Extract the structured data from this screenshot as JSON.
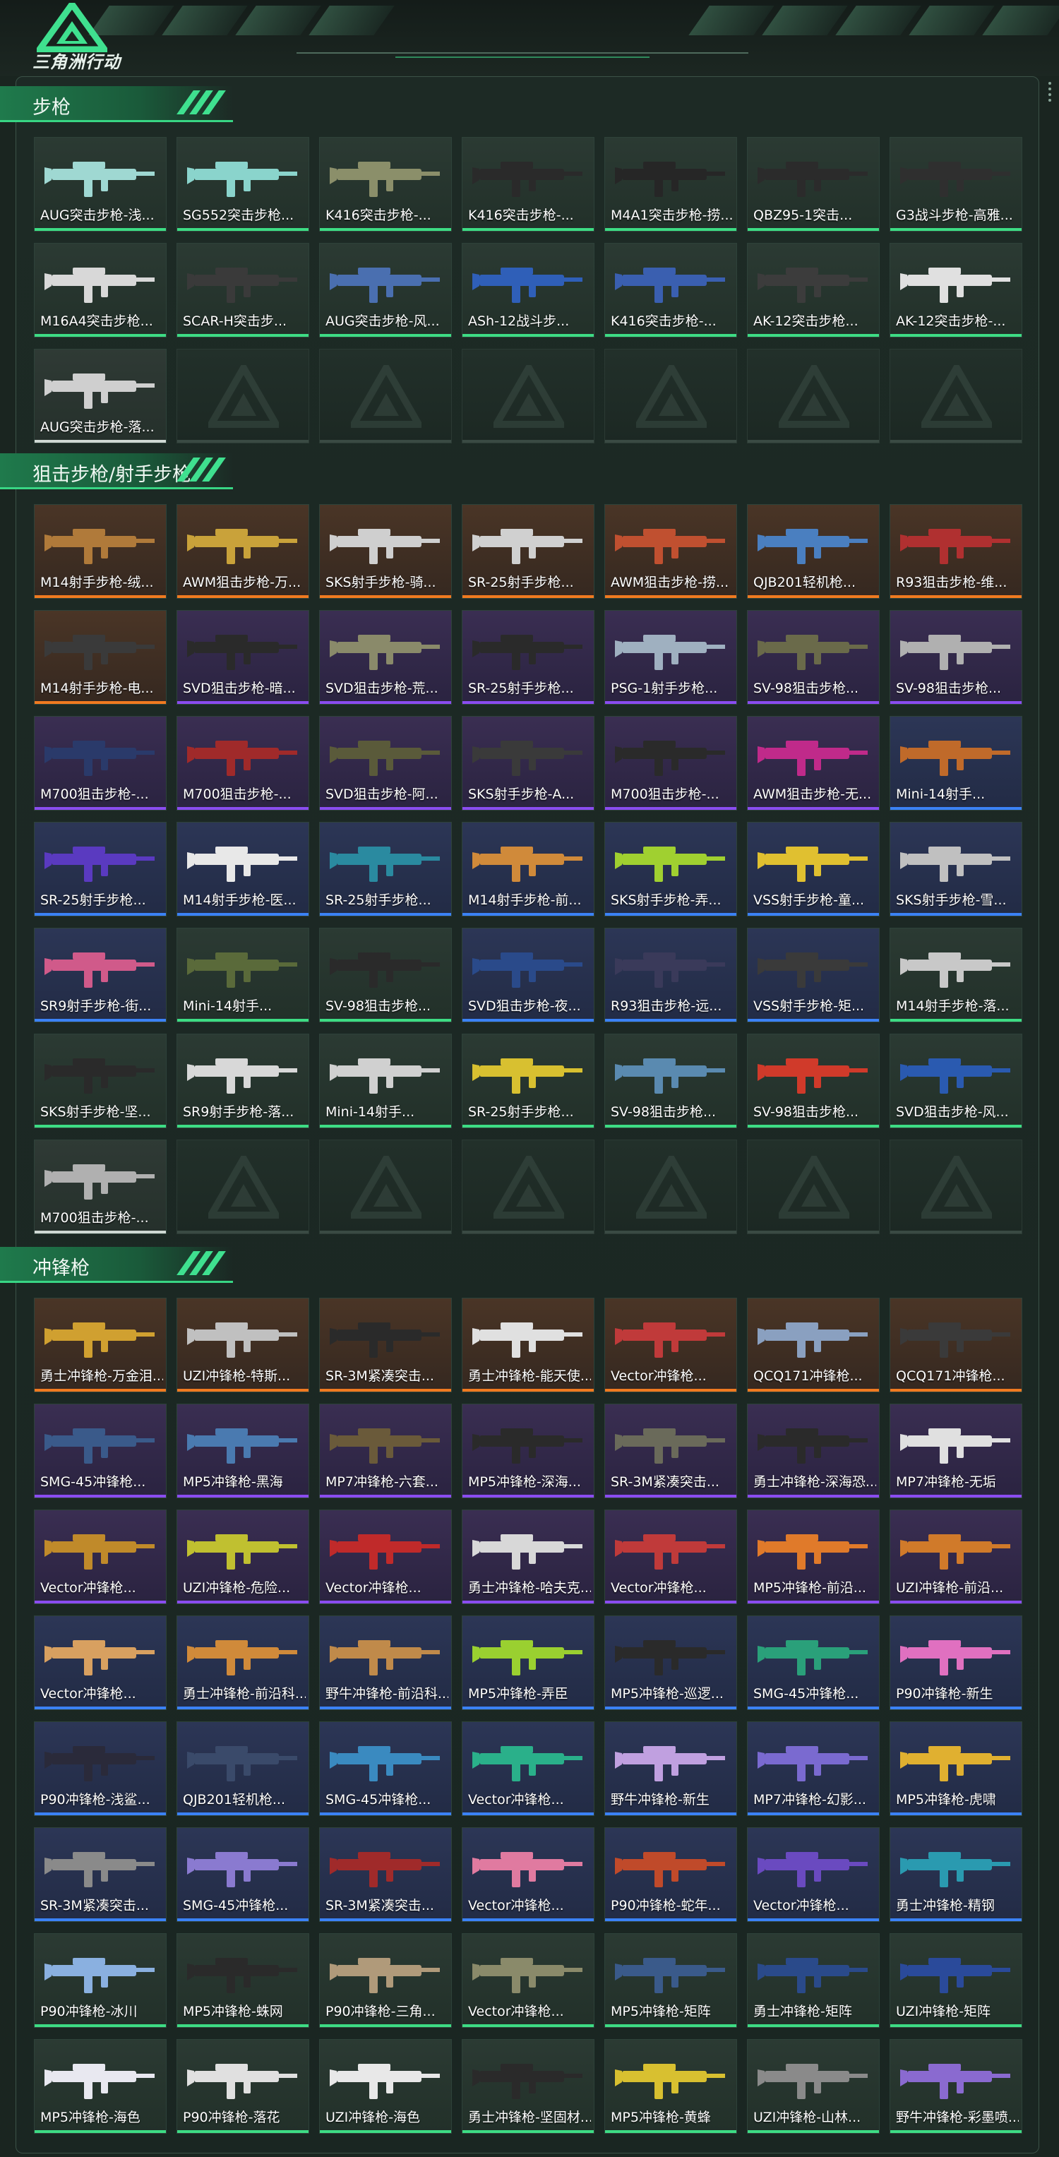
{
  "app": {
    "logo_text": "三角洲行动"
  },
  "colors": {
    "green_bar": "#3ddc84",
    "orange_bar": "#f07a20",
    "purple_bar": "#8a4cf0",
    "blue_bar": "#3b82f6",
    "white_bar": "#cfd8d3"
  },
  "sections": [
    {
      "title": "步枪",
      "items": [
        {
          "label": "AUG突击步枪-浅...",
          "rarity": "green",
          "gun": "#9fd8d2"
        },
        {
          "label": "SG552突击步枪...",
          "rarity": "green",
          "gun": "#8ad4cc"
        },
        {
          "label": "K416突击步枪-...",
          "rarity": "green",
          "gun": "#8b8f6a"
        },
        {
          "label": "K416突击步枪-...",
          "rarity": "green",
          "gun": "#2a2a2a"
        },
        {
          "label": "M4A1突击步枪-捞...",
          "rarity": "green",
          "gun": "#262626"
        },
        {
          "label": "QBZ95-1突击...",
          "rarity": "green",
          "gun": "#2b2b2b"
        },
        {
          "label": "G3战斗步枪-高雅...",
          "rarity": "green",
          "gun": "#2f2f2f"
        },
        {
          "label": "M16A4突击步枪...",
          "rarity": "green",
          "gun": "#d8d8d8"
        },
        {
          "label": "SCAR-H突击步...",
          "rarity": "green",
          "gun": "#3a3a3a"
        },
        {
          "label": "AUG突击步枪-风...",
          "rarity": "green",
          "gun": "#4a6fb0"
        },
        {
          "label": "ASh-12战斗步...",
          "rarity": "green",
          "gun": "#2f5fb8"
        },
        {
          "label": "K416突击步枪-...",
          "rarity": "green",
          "gun": "#3a5fb0"
        },
        {
          "label": "AK-12突击步枪...",
          "rarity": "green",
          "gun": "#3c3c3c"
        },
        {
          "label": "AK-12突击步枪-...",
          "rarity": "green",
          "gun": "#e0e0e0"
        },
        {
          "label": "AUG突击步枪-落...",
          "rarity": "white",
          "gun": "#cfcfcf"
        }
      ]
    },
    {
      "title": "狙击步枪/射手步枪",
      "items": [
        {
          "label": "M14射手步枪-绒...",
          "rarity": "orange",
          "gun": "#b07a3a"
        },
        {
          "label": "AWM狙击步枪-万...",
          "rarity": "orange",
          "gun": "#c9a23a"
        },
        {
          "label": "SKS射手步枪-骑...",
          "rarity": "orange",
          "gun": "#cfcfcf"
        },
        {
          "label": "SR-25射手步枪...",
          "rarity": "orange",
          "gun": "#d0d0d0"
        },
        {
          "label": "AWM狙击步枪-捞...",
          "rarity": "orange",
          "gun": "#c05030"
        },
        {
          "label": "QJB201轻机枪...",
          "rarity": "orange",
          "gun": "#4a7fc0"
        },
        {
          "label": "R93狙击步枪-维...",
          "rarity": "orange",
          "gun": "#b03030"
        },
        {
          "label": "M14射手步枪-电...",
          "rarity": "orange",
          "gun": "#3a3a3a"
        },
        {
          "label": "SVD狙击步枪-暗...",
          "rarity": "purple",
          "gun": "#2a2a2a"
        },
        {
          "label": "SVD狙击步枪-荒...",
          "rarity": "purple",
          "gun": "#8a8a6a"
        },
        {
          "label": "SR-25射手步枪...",
          "rarity": "purple",
          "gun": "#2a2a2a"
        },
        {
          "label": "PSG-1射手步枪...",
          "rarity": "purple",
          "gun": "#9fb0c0"
        },
        {
          "label": "SV-98狙击步枪...",
          "rarity": "purple",
          "gun": "#6a6a4a"
        },
        {
          "label": "SV-98狙击步枪...",
          "rarity": "purple",
          "gun": "#b0b0b0"
        },
        {
          "label": "M700狙击步枪-...",
          "rarity": "purple",
          "gun": "#2a3a6a"
        },
        {
          "label": "M700狙击步枪-...",
          "rarity": "purple",
          "gun": "#a02a2a"
        },
        {
          "label": "SVD狙击步枪-阿...",
          "rarity": "purple",
          "gun": "#5a5a3a"
        },
        {
          "label": "SKS射手步枪-A...",
          "rarity": "purple",
          "gun": "#3a3a3a"
        },
        {
          "label": "M700狙击步枪-...",
          "rarity": "purple",
          "gun": "#2a2a2a"
        },
        {
          "label": "AWM狙击步枪-无...",
          "rarity": "purple",
          "gun": "#c02a8a"
        },
        {
          "label": "Mini-14射手...",
          "rarity": "blue",
          "gun": "#c06a2a"
        },
        {
          "label": "SR-25射手步枪...",
          "rarity": "blue",
          "gun": "#5a3ac0"
        },
        {
          "label": "M14射手步枪-医...",
          "rarity": "blue",
          "gun": "#e8e8e8"
        },
        {
          "label": "SR-25射手步枪...",
          "rarity": "blue",
          "gun": "#2a8aa0"
        },
        {
          "label": "M14射手步枪-前...",
          "rarity": "blue",
          "gun": "#d08a3a"
        },
        {
          "label": "SKS射手步枪-弄...",
          "rarity": "blue",
          "gun": "#a0d030"
        },
        {
          "label": "VSS射手步枪-童...",
          "rarity": "blue",
          "gun": "#e0c030"
        },
        {
          "label": "SKS射手步枪-雪...",
          "rarity": "blue",
          "gun": "#c0c0c0"
        },
        {
          "label": "SR9射手步枪-街...",
          "rarity": "blue",
          "gun": "#d05a8a"
        },
        {
          "label": "Mini-14射手...",
          "rarity": "green",
          "gun": "#5a6a3a"
        },
        {
          "label": "SV-98狙击步枪...",
          "rarity": "green",
          "gun": "#2a2a2a"
        },
        {
          "label": "SVD狙击步枪-夜...",
          "rarity": "blue",
          "gun": "#2a4a8a"
        },
        {
          "label": "R93狙击步枪-远...",
          "rarity": "blue",
          "gun": "#3a3a5a"
        },
        {
          "label": "VSS射手步枪-矩...",
          "rarity": "blue",
          "gun": "#3a3a3a"
        },
        {
          "label": "M14射手步枪-落...",
          "rarity": "green",
          "gun": "#c8c8c8"
        },
        {
          "label": "SKS射手步枪-坚...",
          "rarity": "green",
          "gun": "#2a2a2a"
        },
        {
          "label": "SR9射手步枪-落...",
          "rarity": "green",
          "gun": "#d8d8d8"
        },
        {
          "label": "Mini-14射手...",
          "rarity": "green",
          "gun": "#d0d0d0"
        },
        {
          "label": "SR-25射手步枪...",
          "rarity": "green",
          "gun": "#d8c030"
        },
        {
          "label": "SV-98狙击步枪...",
          "rarity": "green",
          "gun": "#5a8ab0"
        },
        {
          "label": "SV-98狙击步枪...",
          "rarity": "green",
          "gun": "#d03a2a"
        },
        {
          "label": "SVD狙击步枪-风...",
          "rarity": "green",
          "gun": "#2a5ab0"
        },
        {
          "label": "M700狙击步枪-...",
          "rarity": "white",
          "gun": "#b0b0b0"
        }
      ]
    },
    {
      "title": "冲锋枪",
      "items": [
        {
          "label": "勇士冲锋枪-万金泪...",
          "rarity": "orange",
          "gun": "#d0a030"
        },
        {
          "label": "UZI冲锋枪-特斯...",
          "rarity": "orange",
          "gun": "#c0c0c0"
        },
        {
          "label": "SR-3M紧凑突击...",
          "rarity": "orange",
          "gun": "#2a2a2a"
        },
        {
          "label": "勇士冲锋枪-能天使...",
          "rarity": "orange",
          "gun": "#e0e0e0"
        },
        {
          "label": "Vector冲锋枪...",
          "rarity": "orange",
          "gun": "#c03a3a"
        },
        {
          "label": "QCQ171冲锋枪...",
          "rarity": "orange",
          "gun": "#8aa0c0"
        },
        {
          "label": "QCQ171冲锋枪...",
          "rarity": "orange",
          "gun": "#3a3a3a"
        },
        {
          "label": "SMG-45冲锋枪...",
          "rarity": "purple",
          "gun": "#3a5a8a"
        },
        {
          "label": "MP5冲锋枪-黑海",
          "rarity": "purple",
          "gun": "#4a7ab0"
        },
        {
          "label": "MP7冲锋枪-六套...",
          "rarity": "purple",
          "gun": "#6a5a3a"
        },
        {
          "label": "MP5冲锋枪-深海...",
          "rarity": "purple",
          "gun": "#2a2a2a"
        },
        {
          "label": "SR-3M紧凑突击...",
          "rarity": "purple",
          "gun": "#6a6a5a"
        },
        {
          "label": "勇士冲锋枪-深海恐...",
          "rarity": "purple",
          "gun": "#2a2a2a"
        },
        {
          "label": "MP7冲锋枪-无垢",
          "rarity": "purple",
          "gun": "#e0e0e0"
        },
        {
          "label": "Vector冲锋枪...",
          "rarity": "purple",
          "gun": "#c08a2a"
        },
        {
          "label": "UZI冲锋枪-危险...",
          "rarity": "purple",
          "gun": "#c0c030"
        },
        {
          "label": "Vector冲锋枪...",
          "rarity": "purple",
          "gun": "#c02a2a"
        },
        {
          "label": "勇士冲锋枪-哈夫克...",
          "rarity": "purple",
          "gun": "#d8d8d8"
        },
        {
          "label": "Vector冲锋枪...",
          "rarity": "purple",
          "gun": "#c03a3a"
        },
        {
          "label": "MP5冲锋枪-前沿...",
          "rarity": "purple",
          "gun": "#e07a2a"
        },
        {
          "label": "UZI冲锋枪-前沿...",
          "rarity": "purple",
          "gun": "#d07a2a"
        },
        {
          "label": "Vector冲锋枪...",
          "rarity": "blue",
          "gun": "#d8a060"
        },
        {
          "label": "勇士冲锋枪-前沿科...",
          "rarity": "blue",
          "gun": "#d08a3a"
        },
        {
          "label": "野牛冲锋枪-前沿科...",
          "rarity": "blue",
          "gun": "#c08a4a"
        },
        {
          "label": "MP5冲锋枪-弄臣",
          "rarity": "blue",
          "gun": "#9ad030"
        },
        {
          "label": "MP5冲锋枪-巡逻...",
          "rarity": "blue",
          "gun": "#2a2a2a"
        },
        {
          "label": "SMG-45冲锋枪...",
          "rarity": "blue",
          "gun": "#2aa07a"
        },
        {
          "label": "P90冲锋枪-新生",
          "rarity": "blue",
          "gun": "#e070c0"
        },
        {
          "label": "P90冲锋枪-浅鲨...",
          "rarity": "blue",
          "gun": "#2a2a3a"
        },
        {
          "label": "QJB201轻机枪...",
          "rarity": "blue",
          "gun": "#3a4a6a"
        },
        {
          "label": "SMG-45冲锋枪...",
          "rarity": "blue",
          "gun": "#3a8ac0"
        },
        {
          "label": "Vector冲锋枪...",
          "rarity": "blue",
          "gun": "#2ab08a"
        },
        {
          "label": "野牛冲锋枪-新生",
          "rarity": "blue",
          "gun": "#c0a0e0"
        },
        {
          "label": "MP7冲锋枪-幻影...",
          "rarity": "blue",
          "gun": "#7a6ad0"
        },
        {
          "label": "MP5冲锋枪-虎啸",
          "rarity": "blue",
          "gun": "#e0b030"
        },
        {
          "label": "SR-3M紧凑突击...",
          "rarity": "blue",
          "gun": "#8a8a8a"
        },
        {
          "label": "SMG-45冲锋枪...",
          "rarity": "blue",
          "gun": "#8a7ad0"
        },
        {
          "label": "SR-3M紧凑突击...",
          "rarity": "blue",
          "gun": "#a02a2a"
        },
        {
          "label": "Vector冲锋枪...",
          "rarity": "blue",
          "gun": "#e07aa0"
        },
        {
          "label": "P90冲锋枪-蛇年...",
          "rarity": "blue",
          "gun": "#c04a2a"
        },
        {
          "label": "Vector冲锋枪...",
          "rarity": "blue",
          "gun": "#6a4ac0"
        },
        {
          "label": "勇士冲锋枪-精钢",
          "rarity": "blue",
          "gun": "#2a9ab0"
        },
        {
          "label": "P90冲锋枪-冰川",
          "rarity": "green",
          "gun": "#8ab0e0"
        },
        {
          "label": "MP5冲锋枪-蛛网",
          "rarity": "green",
          "gun": "#2a2a2a"
        },
        {
          "label": "P90冲锋枪-三角...",
          "rarity": "green",
          "gun": "#b09a7a"
        },
        {
          "label": "Vector冲锋枪...",
          "rarity": "green",
          "gun": "#8a8a6a"
        },
        {
          "label": "MP5冲锋枪-矩阵",
          "rarity": "green",
          "gun": "#3a5a8a"
        },
        {
          "label": "勇士冲锋枪-矩阵",
          "rarity": "green",
          "gun": "#2a4a8a"
        },
        {
          "label": "UZI冲锋枪-矩阵",
          "rarity": "green",
          "gun": "#2a4a9a"
        },
        {
          "label": "MP5冲锋枪-海色",
          "rarity": "green",
          "gun": "#e8e8f0"
        },
        {
          "label": "P90冲锋枪-落花",
          "rarity": "green",
          "gun": "#e0e0e0"
        },
        {
          "label": "UZI冲锋枪-海色",
          "rarity": "green",
          "gun": "#e8e8e8"
        },
        {
          "label": "勇士冲锋枪-坚固材...",
          "rarity": "green",
          "gun": "#2a2a2a"
        },
        {
          "label": "MP5冲锋枪-黄蜂",
          "rarity": "green",
          "gun": "#d8c030"
        },
        {
          "label": "UZI冲锋枪-山林...",
          "rarity": "green",
          "gun": "#8a8a8a"
        },
        {
          "label": "野牛冲锋枪-彩墨喷...",
          "rarity": "green",
          "gun": "#8a6ad0"
        }
      ]
    }
  ]
}
